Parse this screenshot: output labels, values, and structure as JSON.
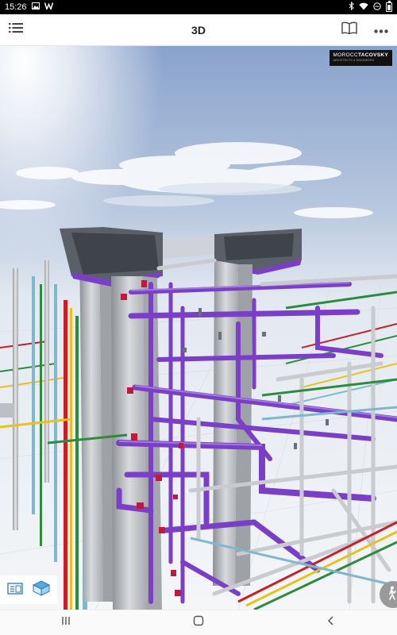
{
  "status_bar": {
    "time": "15:26",
    "left_icons": [
      "image-icon",
      "w-app-icon"
    ],
    "right_icons": [
      "bluetooth-icon",
      "wifi-icon",
      "do-not-disturb-icon",
      "battery-icon"
    ]
  },
  "app_bar": {
    "title": "3D",
    "left_icon": "list-menu-icon",
    "right_icons": [
      "book-icon",
      "more-options-icon"
    ]
  },
  "viewer": {
    "logo_text_part1": "MOROCC",
    "logo_text_part2": "TACOVSKY",
    "logo_subtext": "ARCHITECTS & ENGINEERS",
    "bottom_tools": [
      "sheets-icon",
      "3d-box-icon"
    ],
    "walk_icon": "walk-person-icon",
    "colors": {
      "sky_top": "#8fa6cf",
      "sky_bottom": "#e8edf3",
      "duct_purple": "#7a3fc6",
      "duct_gray": "#b8bcc2",
      "pipe_red": "#c81e28",
      "pipe_green": "#2e8b3e",
      "pipe_yellow": "#e8c21a",
      "pipe_blue": "#7fb7cf",
      "fitting_red": "#c2183b"
    }
  },
  "nav_bar": {
    "buttons": [
      "recent-apps-icon",
      "home-icon",
      "back-icon"
    ]
  }
}
